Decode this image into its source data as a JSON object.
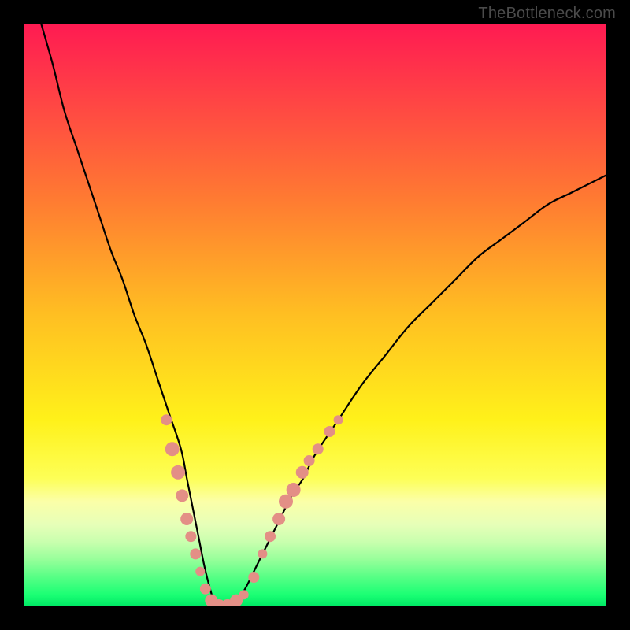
{
  "watermark": "TheBottleneck.com",
  "colors": {
    "black": "#000000",
    "curve": "#000000",
    "dot_fill": "#e38f86",
    "dot_stroke": "#c77168"
  },
  "chart_data": {
    "type": "line",
    "title": "",
    "xlabel": "",
    "ylabel": "",
    "xlim": [
      0,
      100
    ],
    "ylim": [
      0,
      100
    ],
    "gradient_stops": [
      {
        "pos": 0,
        "color": "#ff1a52"
      },
      {
        "pos": 0.1,
        "color": "#ff3a48"
      },
      {
        "pos": 0.3,
        "color": "#ff7a32"
      },
      {
        "pos": 0.5,
        "color": "#ffbf22"
      },
      {
        "pos": 0.68,
        "color": "#fff11a"
      },
      {
        "pos": 0.78,
        "color": "#fdff56"
      },
      {
        "pos": 0.82,
        "color": "#fbffa8"
      },
      {
        "pos": 0.86,
        "color": "#e6ffb8"
      },
      {
        "pos": 0.89,
        "color": "#c8ffae"
      },
      {
        "pos": 0.92,
        "color": "#96ff9a"
      },
      {
        "pos": 0.95,
        "color": "#56ff85"
      },
      {
        "pos": 0.98,
        "color": "#1bff74"
      },
      {
        "pos": 1.0,
        "color": "#00e865"
      }
    ],
    "series": [
      {
        "name": "bottleneck-curve",
        "x": [
          3,
          5,
          7,
          9,
          11,
          13,
          15,
          17,
          19,
          21,
          23,
          25,
          27,
          28,
          29,
          30,
          31,
          32,
          33,
          34,
          36,
          38,
          40,
          42,
          44,
          46,
          48,
          50,
          54,
          58,
          62,
          66,
          70,
          74,
          78,
          82,
          86,
          90,
          94,
          98,
          100
        ],
        "y": [
          100,
          93,
          85,
          79,
          73,
          67,
          61,
          56,
          50,
          45,
          39,
          33,
          27,
          22,
          17,
          12,
          7,
          3,
          0,
          0,
          0,
          3,
          7,
          11,
          15,
          19,
          22,
          26,
          32,
          38,
          43,
          48,
          52,
          56,
          60,
          63,
          66,
          69,
          71,
          73,
          74
        ]
      }
    ],
    "scatter": [
      {
        "x": 24.5,
        "y": 32,
        "r": 7
      },
      {
        "x": 25.5,
        "y": 27,
        "r": 9
      },
      {
        "x": 26.5,
        "y": 23,
        "r": 9
      },
      {
        "x": 27.2,
        "y": 19,
        "r": 8
      },
      {
        "x": 28.0,
        "y": 15,
        "r": 8
      },
      {
        "x": 28.7,
        "y": 12,
        "r": 7
      },
      {
        "x": 29.5,
        "y": 9,
        "r": 7
      },
      {
        "x": 30.3,
        "y": 6,
        "r": 6
      },
      {
        "x": 31.2,
        "y": 3,
        "r": 7
      },
      {
        "x": 32.2,
        "y": 1,
        "r": 8
      },
      {
        "x": 33.5,
        "y": 0,
        "r": 9
      },
      {
        "x": 35.0,
        "y": 0,
        "r": 9
      },
      {
        "x": 36.5,
        "y": 1,
        "r": 8
      },
      {
        "x": 37.8,
        "y": 2,
        "r": 6
      },
      {
        "x": 39.5,
        "y": 5,
        "r": 7
      },
      {
        "x": 41.0,
        "y": 9,
        "r": 6
      },
      {
        "x": 42.3,
        "y": 12,
        "r": 7
      },
      {
        "x": 43.8,
        "y": 15,
        "r": 8
      },
      {
        "x": 45.0,
        "y": 18,
        "r": 9
      },
      {
        "x": 46.3,
        "y": 20,
        "r": 9
      },
      {
        "x": 47.8,
        "y": 23,
        "r": 8
      },
      {
        "x": 49.0,
        "y": 25,
        "r": 7
      },
      {
        "x": 50.5,
        "y": 27,
        "r": 7
      },
      {
        "x": 52.5,
        "y": 30,
        "r": 7
      },
      {
        "x": 54.0,
        "y": 32,
        "r": 6
      }
    ]
  }
}
